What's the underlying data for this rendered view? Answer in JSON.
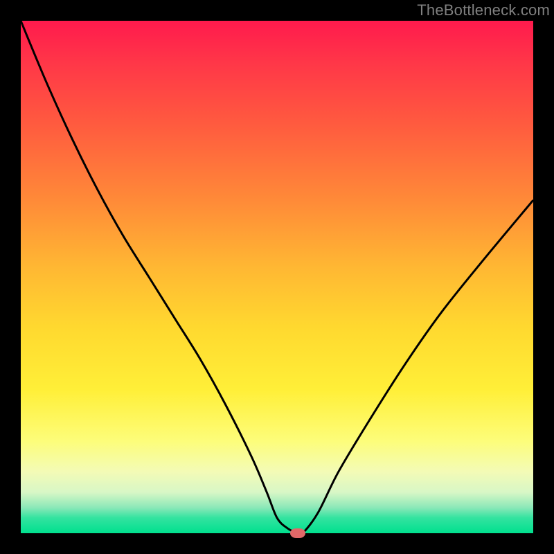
{
  "watermark": "TheBottleneck.com",
  "colors": {
    "frame_border": "#000000",
    "curve_stroke": "#000000",
    "marker_fill": "#e06868",
    "gradient_top": "#ff1a4d",
    "gradient_bottom": "#00e08e"
  },
  "chart_data": {
    "type": "line",
    "title": "",
    "xlabel": "",
    "ylabel": "",
    "xlim": [
      0,
      100
    ],
    "ylim": [
      0,
      100
    ],
    "x": [
      0,
      5,
      10,
      15,
      20,
      25,
      30,
      35,
      40,
      45,
      48,
      50,
      52,
      54,
      55,
      58,
      62,
      68,
      75,
      82,
      90,
      100
    ],
    "y": [
      100,
      88,
      77,
      67,
      58,
      50,
      42,
      34,
      25,
      15,
      8,
      3,
      1,
      0,
      0,
      4,
      12,
      22,
      33,
      43,
      53,
      65
    ],
    "marker": {
      "x": 54,
      "y": 0
    },
    "grid": false,
    "legend": false
  }
}
